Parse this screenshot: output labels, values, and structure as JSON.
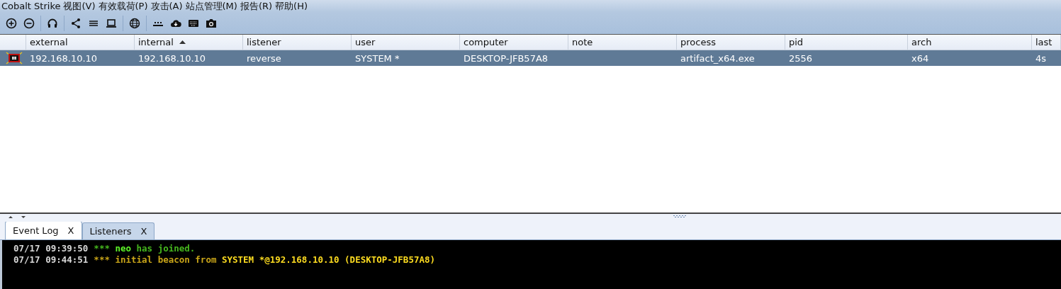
{
  "menu_bar": {
    "items": [
      {
        "label": "Cobalt Strike"
      },
      {
        "label": "视图(V)"
      },
      {
        "label": "有效载荷(P)"
      },
      {
        "label": "攻击(A)"
      },
      {
        "label": "站点管理(M)"
      },
      {
        "label": "报告(R)"
      },
      {
        "label": "帮助(H)"
      }
    ]
  },
  "table": {
    "columns": [
      {
        "label": "external",
        "sorted": false
      },
      {
        "label": "internal",
        "sorted": true
      },
      {
        "label": "listener",
        "sorted": false
      },
      {
        "label": "user",
        "sorted": false
      },
      {
        "label": "computer",
        "sorted": false
      },
      {
        "label": "note",
        "sorted": false
      },
      {
        "label": "process",
        "sorted": false
      },
      {
        "label": "pid",
        "sorted": false
      },
      {
        "label": "arch",
        "sorted": false
      },
      {
        "label": "last",
        "sorted": false
      }
    ],
    "rows": [
      {
        "selected": true,
        "cells": [
          "192.168.10.10",
          "192.168.10.10",
          "reverse",
          "SYSTEM *",
          "DESKTOP-JFB57A8",
          "",
          "artifact_x64.exe",
          "2556",
          "x64",
          "4s"
        ]
      }
    ]
  },
  "tabs": [
    {
      "label": "Event Log",
      "close": "X",
      "selected": true
    },
    {
      "label": "Listeners",
      "close": "X",
      "selected": false
    }
  ],
  "event_log": [
    {
      "time": "07/17 09:39:50",
      "color": "#46b81e",
      "parts": [
        {
          "text": "*** ",
          "bold": false
        },
        {
          "text": "neo",
          "bold": true
        },
        {
          "text": " has joined.",
          "bold": false
        }
      ]
    },
    {
      "time": "07/17 09:44:51",
      "color": "#c8a418",
      "parts": [
        {
          "text": "*** initial beacon from ",
          "bold": false
        },
        {
          "text": "SYSTEM *@192.168.10.10 (DESKTOP-JFB57A8)",
          "bold": true
        }
      ]
    }
  ]
}
